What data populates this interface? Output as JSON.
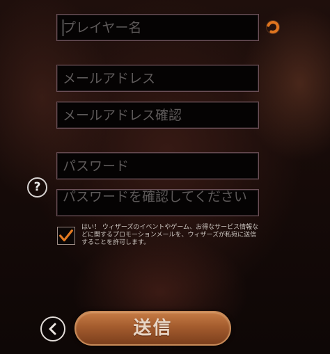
{
  "form": {
    "player_name_placeholder": "プレイヤー名",
    "email_placeholder": "メールアドレス",
    "email_confirm_placeholder": "メールアドレス確認",
    "password_placeholder": "パスワード",
    "password_confirm_placeholder": "パスワードを確認してください",
    "help_label": "?",
    "consent_checked": true,
    "consent_text": "はい！ ウィザーズのイベントやゲーム、お得なサービス情報などに関するプロモーションメールを、ウィザーズが私宛に送信することを許可します。",
    "submit_label": "送信"
  },
  "icons": {
    "spinner": "loading-spinner-icon",
    "help": "question-mark-icon",
    "check": "check-icon",
    "back": "chevron-left-icon"
  },
  "colors": {
    "accent": "#e0751f",
    "button": "#a45c2e"
  }
}
